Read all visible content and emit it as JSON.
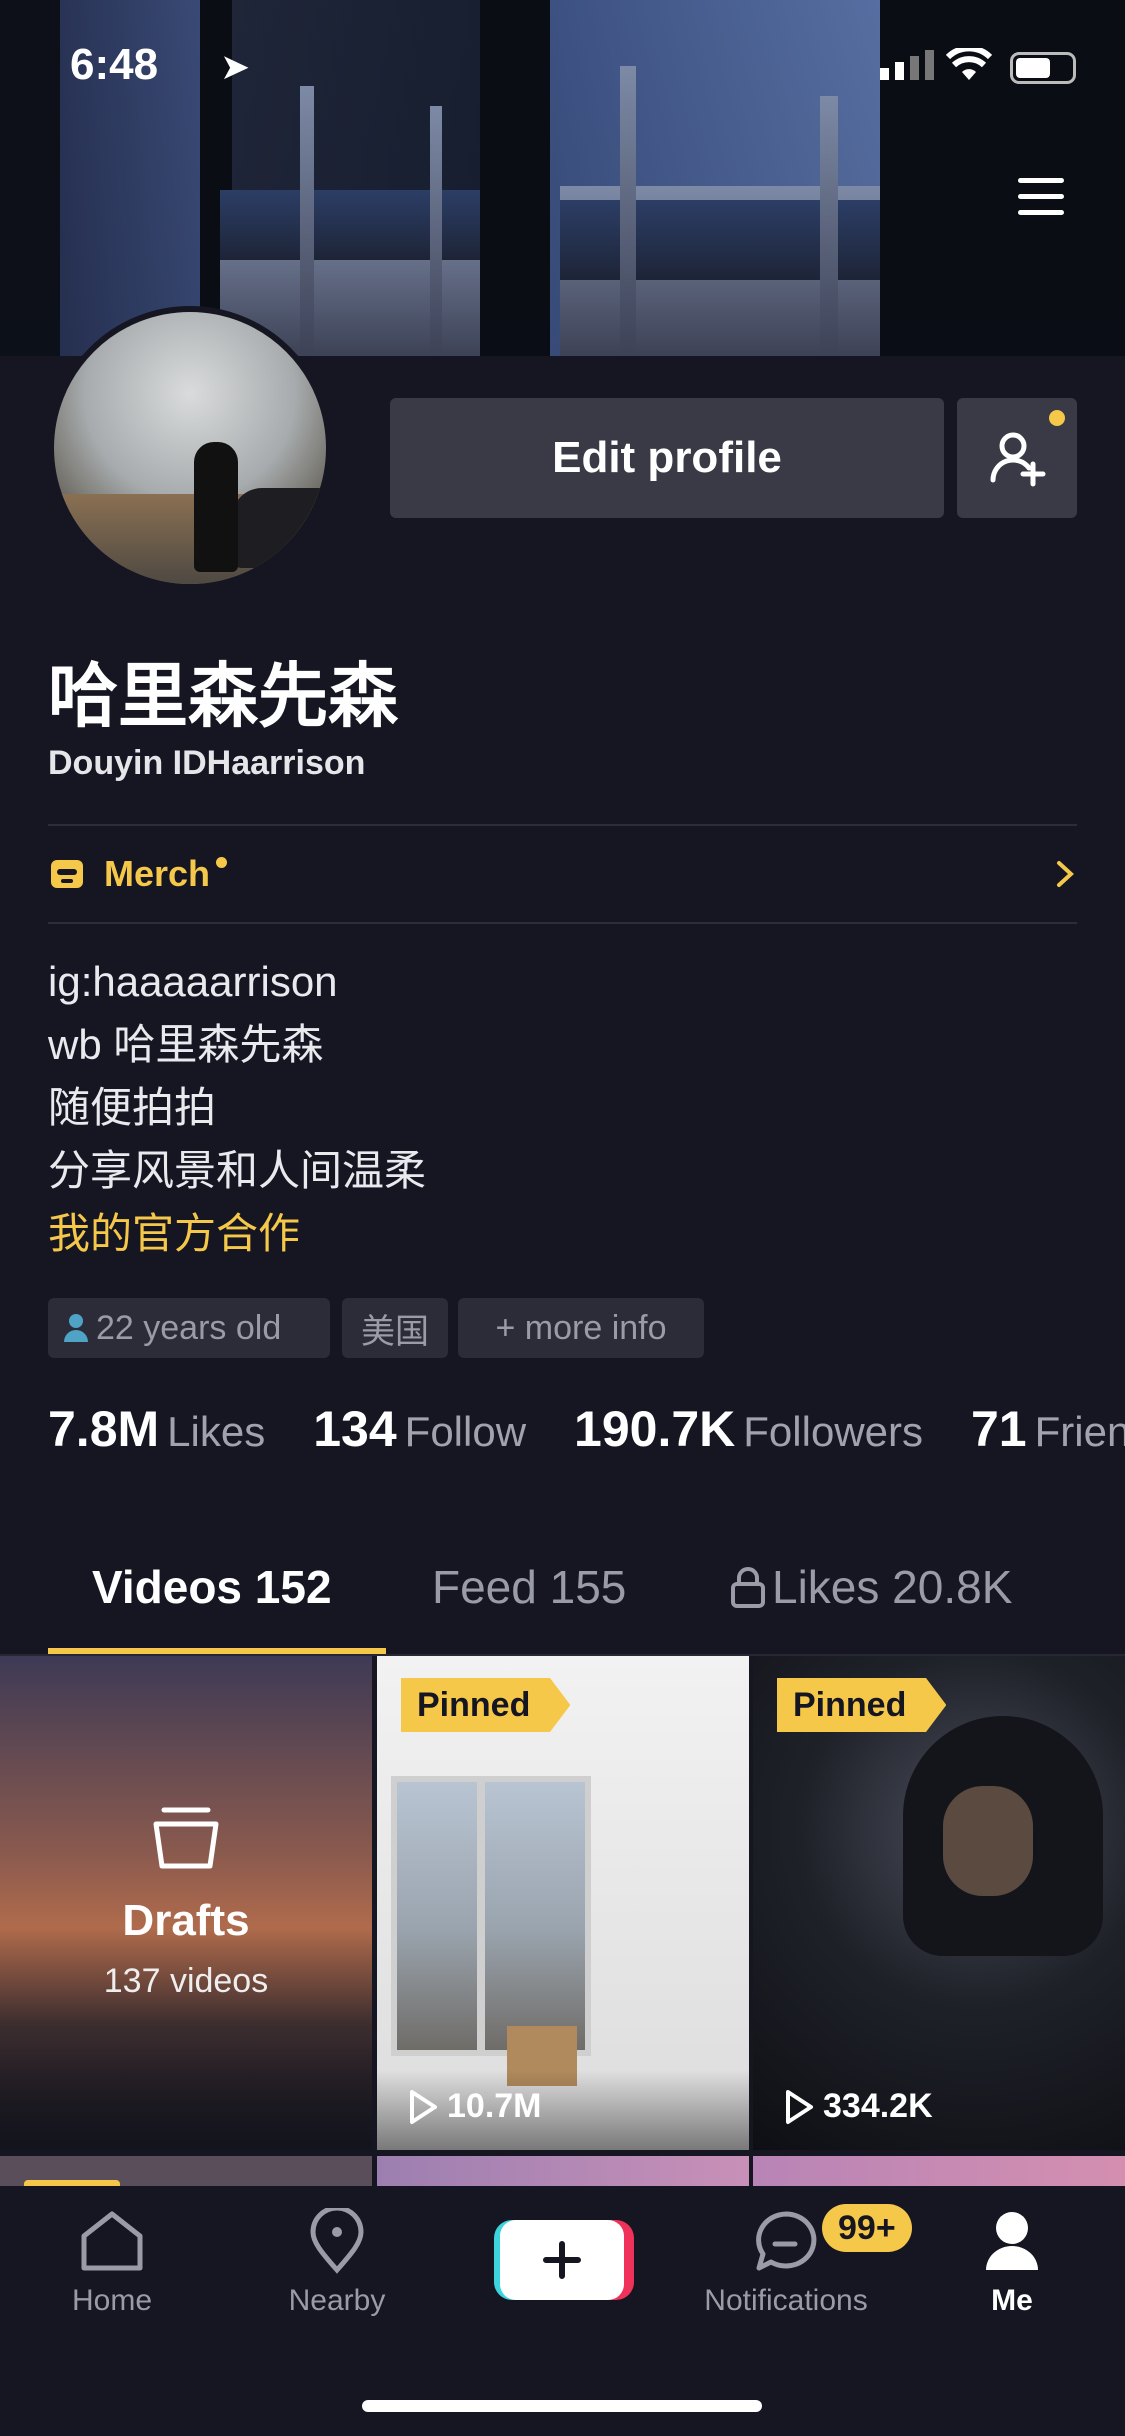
{
  "status_bar": {
    "time": "6:48"
  },
  "profile": {
    "name": "哈里森先森",
    "douyin_id": "Douyin IDHaarrison",
    "edit_button": "Edit profile"
  },
  "merch": {
    "label": "Merch"
  },
  "bio": {
    "lines": [
      "ig:haaaaarrison",
      "wb 哈里森先森",
      "随便拍拍",
      "分享风景和人间温柔"
    ],
    "link": "我的官方合作"
  },
  "tags": {
    "age": "22 years old",
    "location": "美国",
    "more": "+ more info"
  },
  "stats": [
    {
      "num": "7.8M",
      "label": "Likes"
    },
    {
      "num": "134",
      "label": "Follow"
    },
    {
      "num": "190.7K",
      "label": "Followers"
    },
    {
      "num": "71",
      "label": "Friends"
    }
  ],
  "tabs": {
    "videos": "Videos 152",
    "feed": "Feed 155",
    "likes": "Likes 20.8K"
  },
  "grid": {
    "drafts_title": "Drafts",
    "drafts_count": "137 videos",
    "pinned_label": "Pinned",
    "video1_views": "10.7M",
    "video2_views": "334.2K"
  },
  "nav": {
    "home": "Home",
    "nearby": "Nearby",
    "notifications": "Notifications",
    "me": "Me",
    "badge": "99+"
  },
  "colors": {
    "accent": "#f5c84a",
    "background": "#161622"
  }
}
